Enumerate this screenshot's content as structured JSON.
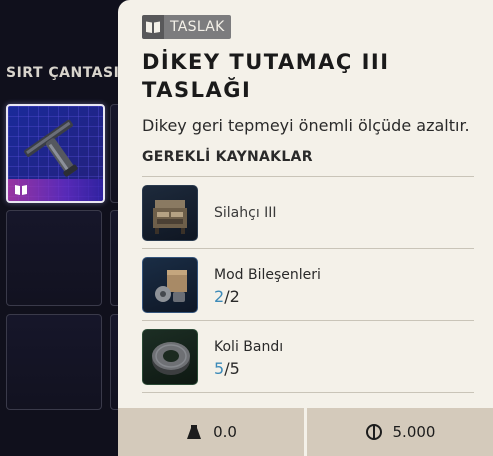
{
  "inventory": {
    "title": "SIRT ÇANTASI"
  },
  "tooltip": {
    "tag_icon": "blueprint-book-icon",
    "tag_label": "TASLAK",
    "title": "DİKEY TUTAMAÇ III TASLAĞI",
    "description": "Dikey geri tepmeyi önemli ölçüde azaltır.",
    "section_header": "GEREKLİ KAYNAKLAR",
    "resources": [
      {
        "name": "Silahçı III",
        "icon": "gunsmith-workbench-icon"
      },
      {
        "name": "Mod Bileşenleri",
        "have": "2",
        "sep": "/",
        "need": "2",
        "icon": "mod-components-icon"
      },
      {
        "name": "Koli Bandı",
        "have": "5",
        "sep": "/",
        "need": "5",
        "icon": "duct-tape-icon"
      }
    ],
    "footer": {
      "weight_icon": "weight-icon",
      "weight": "0.0",
      "price_icon": "currency-icon",
      "price": "5.000"
    }
  },
  "colors": {
    "panel_bg": "#f4f1e9",
    "footer_bg": "#d4cabb",
    "count_accent": "#3c8ab8",
    "slot_selected": "#1a2a9a"
  }
}
